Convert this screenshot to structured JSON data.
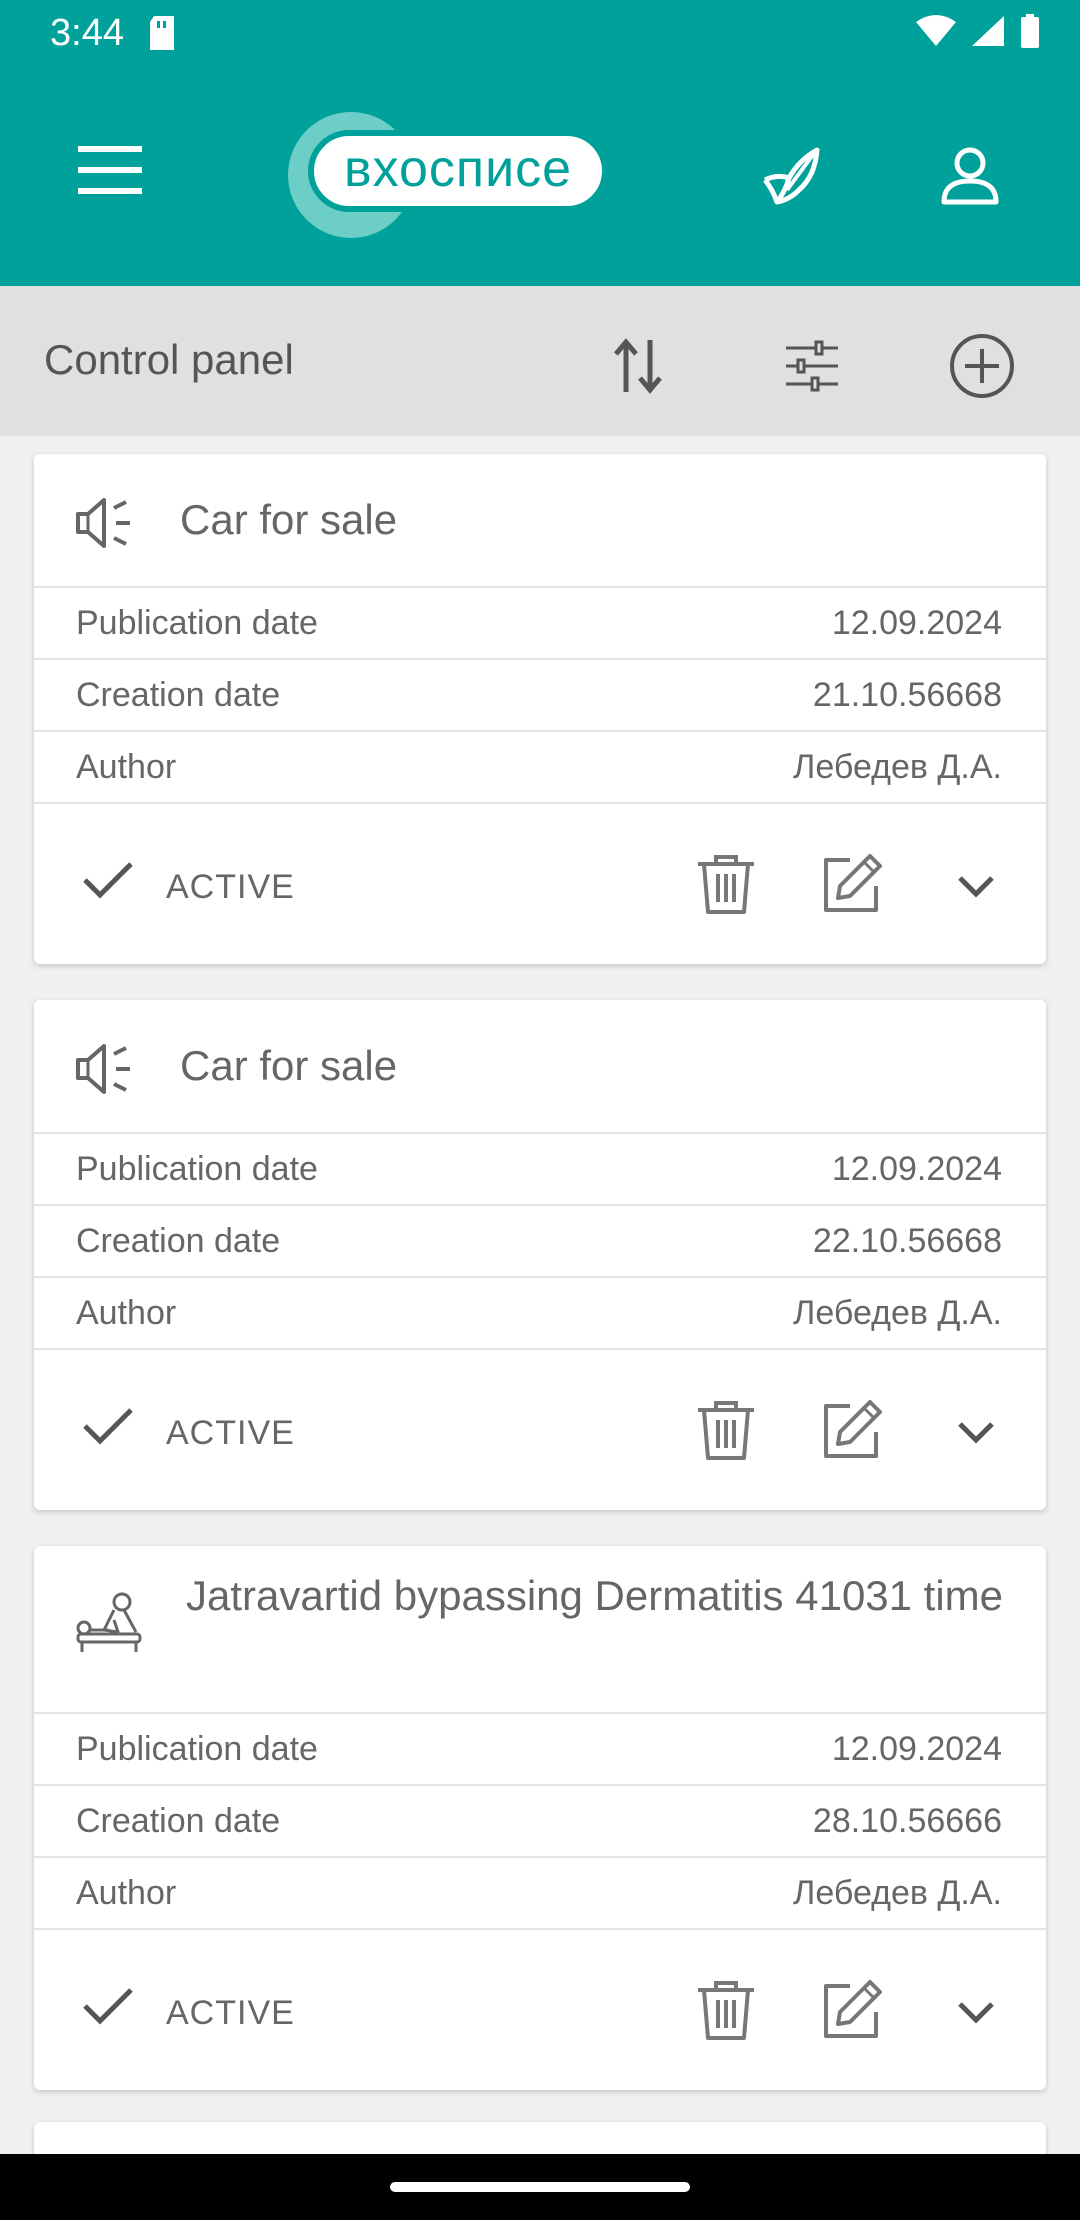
{
  "status_bar": {
    "time": "3:44"
  },
  "app_bar": {
    "logo_text": "вхосписе"
  },
  "control_panel": {
    "title": "Control panel"
  },
  "cards": [
    {
      "icon": "megaphone-icon",
      "title": "Car for sale",
      "rows": [
        {
          "label": "Publication date",
          "value": "12.09.2024"
        },
        {
          "label": "Creation date",
          "value": "21.10.56668"
        },
        {
          "label": "Author",
          "value": "Лебедев Д.А."
        }
      ],
      "status": "ACTIVE"
    },
    {
      "icon": "megaphone-icon",
      "title": "Car for sale",
      "rows": [
        {
          "label": "Publication date",
          "value": "12.09.2024"
        },
        {
          "label": "Creation date",
          "value": "22.10.56668"
        },
        {
          "label": "Author",
          "value": "Лебедев Д.А."
        }
      ],
      "status": "ACTIVE"
    },
    {
      "icon": "massage-icon",
      "title": "Jatravartid bypassing Dermatitis 41031 time",
      "rows": [
        {
          "label": "Publication date",
          "value": "12.09.2024"
        },
        {
          "label": "Creation date",
          "value": "28.10.56666"
        },
        {
          "label": "Author",
          "value": "Лебедев Д.А."
        }
      ],
      "status": "ACTIVE"
    }
  ]
}
